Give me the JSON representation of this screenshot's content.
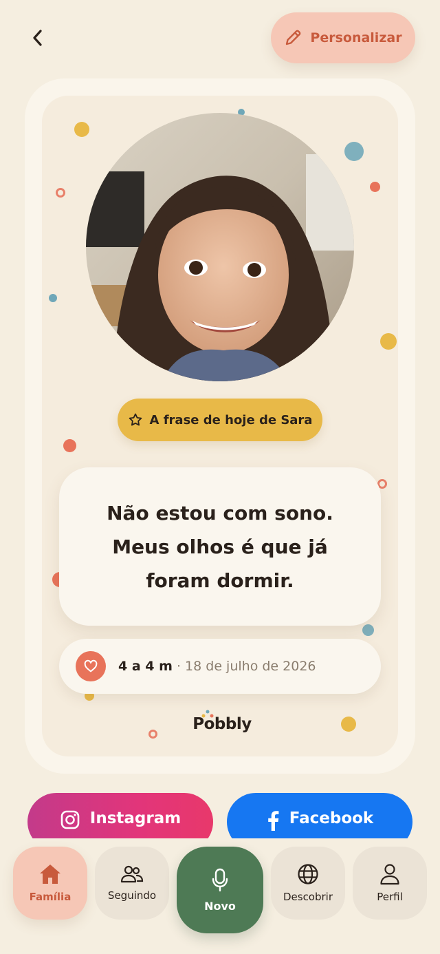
{
  "header": {
    "back_icon": "chevron-left-icon",
    "personalize_label": "Personalizar",
    "personalize_icon": "pencil-icon"
  },
  "card": {
    "photo_alt": "Sara",
    "phrase_badge_label": "A frase de hoje de Sara",
    "quote": "Não estou com sono.\nMeus olhos é que já\nforam dormir.",
    "age": "4 a 4 m",
    "separator": "·",
    "date": "18 de julho de 2026",
    "brand": "Pobbly"
  },
  "share": {
    "instagram_label": "Instagram",
    "facebook_label": "Facebook"
  },
  "tabs": [
    {
      "label": "Família",
      "icon": "home-icon",
      "active": true
    },
    {
      "label": "Seguindo",
      "icon": "users-icon",
      "active": false
    },
    {
      "label": "Novo",
      "icon": "microphone-icon",
      "active": false
    },
    {
      "label": "Descobrir",
      "icon": "globe-icon",
      "active": false
    },
    {
      "label": "Perfil",
      "icon": "user-icon",
      "active": false
    }
  ],
  "colors": {
    "background": "#f5eee0",
    "accent_peach": "#f6c7b6",
    "accent_yellow": "#e8b948",
    "accent_green": "#4e7a55",
    "heart_red": "#e8735a",
    "facebook_blue": "#1677f2",
    "instagram_pink": "#e2357a"
  }
}
